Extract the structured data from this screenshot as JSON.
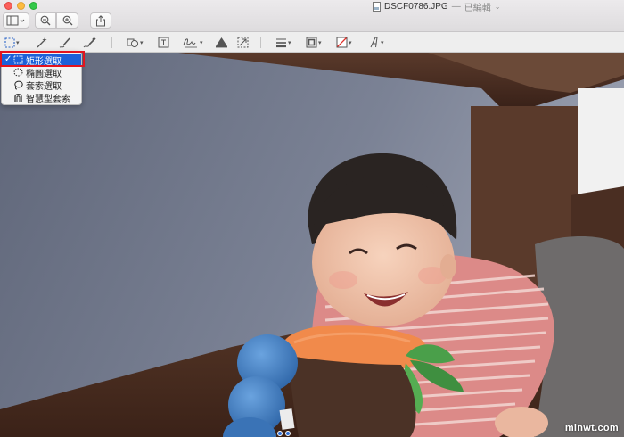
{
  "window": {
    "filename": "DSCF0786.JPG",
    "separator": "—",
    "status": "已編輯",
    "status_chevron": "⌄"
  },
  "toolbar": {
    "buttons": [
      {
        "icon": "sidebar-icon"
      },
      {
        "icon": "zoom-out-icon"
      },
      {
        "icon": "zoom-in-icon"
      },
      {
        "icon": "share-icon"
      }
    ]
  },
  "markup_tools": [
    "rectangular-selection-icon",
    "instant-alpha-icon",
    "sketch-icon",
    "draw-icon",
    "shapes-icon",
    "text-icon",
    "sign-icon",
    "adjust-color-icon",
    "adjust-size-icon",
    "shape-style-icon",
    "border-color-icon",
    "fill-color-icon",
    "text-style-icon"
  ],
  "selection_menu": {
    "items": [
      {
        "label": "矩形選取",
        "icon": "rectangle-selection-icon",
        "checked": true
      },
      {
        "label": "橢圓選取",
        "icon": "ellipse-selection-icon",
        "checked": false
      },
      {
        "label": "套索選取",
        "icon": "lasso-selection-icon",
        "checked": false
      },
      {
        "label": "智慧型套索",
        "icon": "smart-lasso-icon",
        "checked": false
      }
    ],
    "check_mark": "✓"
  },
  "colors": {
    "highlight": "#e3141f",
    "selected_item": "#1d60d9"
  },
  "watermark": "minwt.com"
}
